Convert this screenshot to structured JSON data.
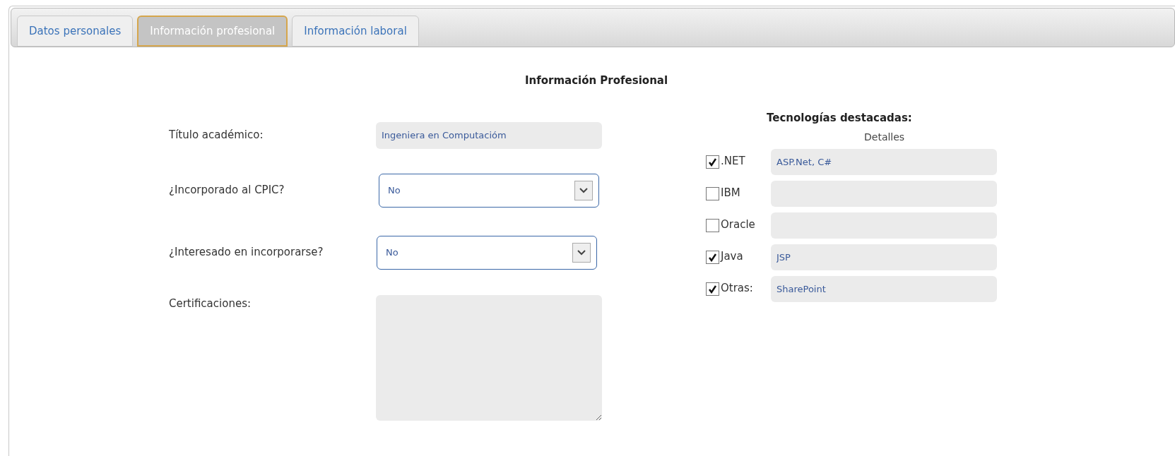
{
  "tabs": [
    {
      "label": "Datos personales",
      "selected": false
    },
    {
      "label": "Información profesional",
      "selected": true
    },
    {
      "label": "Información laboral",
      "selected": false
    }
  ],
  "heading": "Información Profesional",
  "fields": [
    {
      "kind": "text",
      "label": "Título académico:",
      "value": "Ingeniera en Computacióm"
    },
    {
      "kind": "select",
      "label": "¿Incorporado al CPIC?",
      "value": "No"
    },
    {
      "kind": "select",
      "label": "¿Interesado en incorporarse?",
      "value": "No"
    },
    {
      "kind": "textarea",
      "label": "Certificaciones:"
    }
  ],
  "technologies": {
    "title": "Tecnologías destacadas:",
    "details_header": "Detalles",
    "items": [
      {
        "label": ".NET",
        "checked": true,
        "value": "ASP.Net, C#"
      },
      {
        "label": "IBM",
        "checked": false
      },
      {
        "label": "Oracle",
        "checked": false
      },
      {
        "label": "Java",
        "checked": true,
        "value": "JSP"
      },
      {
        "label": "Otras:",
        "checked": true,
        "value": "SharePoint"
      }
    ]
  }
}
